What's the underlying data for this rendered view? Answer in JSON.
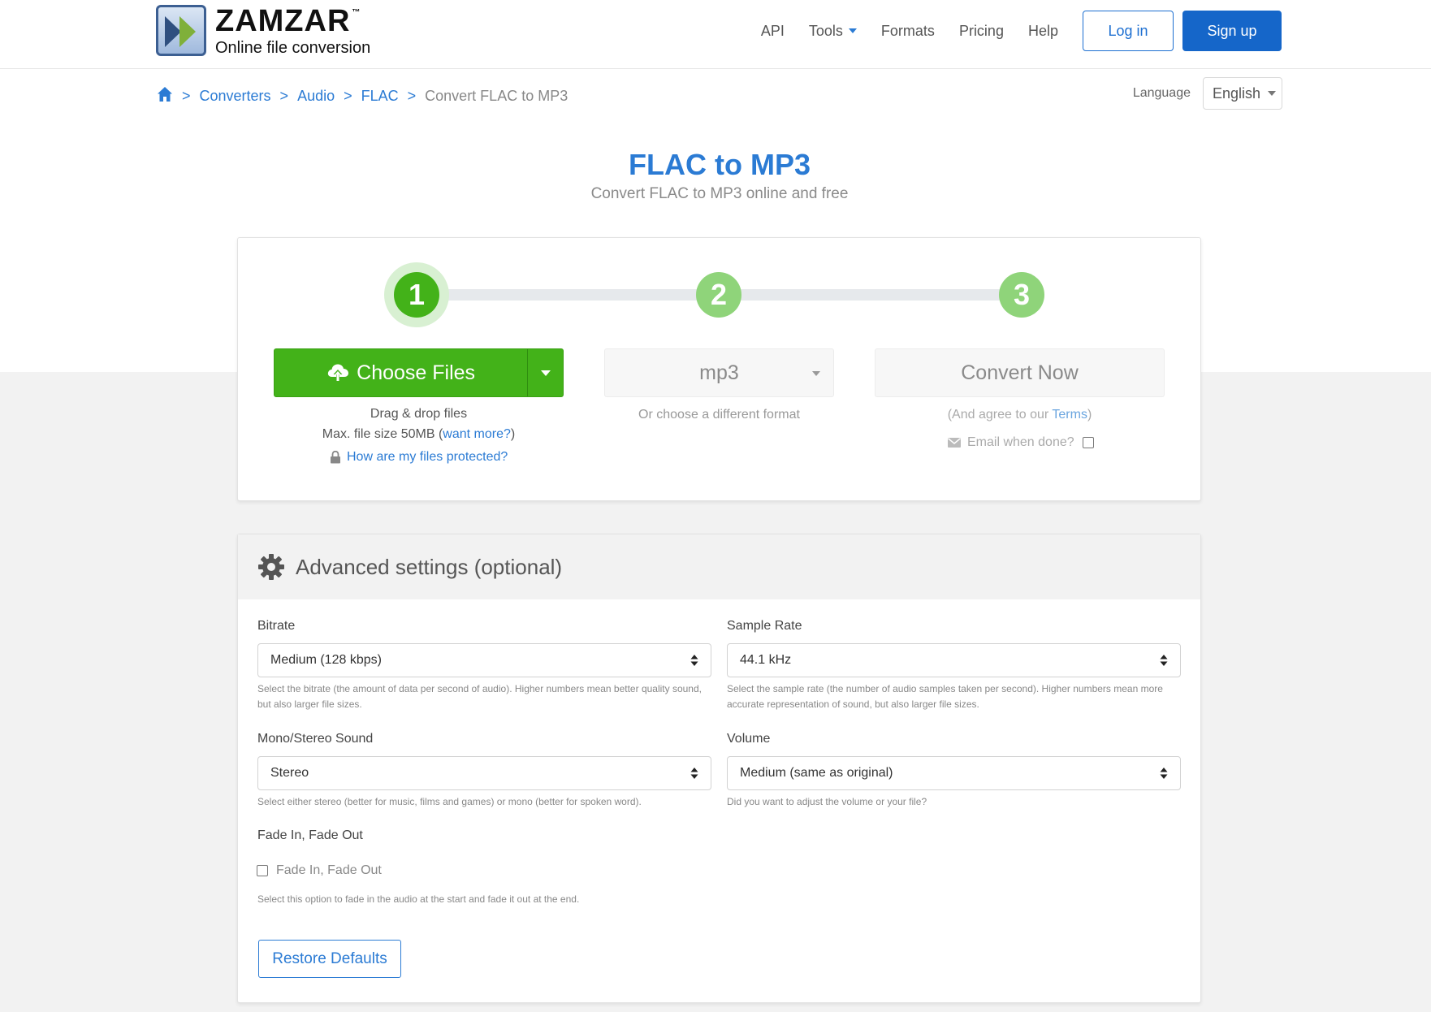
{
  "brand": {
    "name": "ZAMZAR",
    "trademark": "™",
    "tagline": "Online file conversion"
  },
  "nav": {
    "items": [
      {
        "label": "API"
      },
      {
        "label": "Tools"
      },
      {
        "label": "Formats"
      },
      {
        "label": "Pricing"
      },
      {
        "label": "Help"
      }
    ],
    "login_label": "Log in",
    "signup_label": "Sign up"
  },
  "breadcrumb": {
    "items": [
      "Converters",
      "Audio",
      "FLAC"
    ],
    "current": "Convert FLAC to MP3",
    "separator": ">"
  },
  "language": {
    "label": "Language",
    "selected": "English"
  },
  "hero": {
    "title": "FLAC to MP3",
    "subtitle": "Convert FLAC to MP3 online and free"
  },
  "steps": {
    "step1": "1",
    "step2": "2",
    "step3": "3",
    "choose_files_label": "Choose Files",
    "drag_drop": "Drag & drop files",
    "max_size_prefix": "Max. file size 50MB (",
    "want_more": "want more?",
    "max_size_suffix": ")",
    "protected_link": "How are my files protected?",
    "format_value": "mp3",
    "format_hint": "Or choose a different format",
    "convert_label": "Convert Now",
    "terms_prefix": "(And agree to our ",
    "terms_link": "Terms",
    "terms_suffix": ")",
    "email_label": "Email when done?"
  },
  "advanced": {
    "title": "Advanced settings (optional)",
    "bitrate": {
      "label": "Bitrate",
      "value": "Medium (128 kbps)",
      "help": "Select the bitrate (the amount of data per second of audio). Higher numbers mean better quality sound, but also larger file sizes."
    },
    "sample_rate": {
      "label": "Sample Rate",
      "value": "44.1 kHz",
      "help": "Select the sample rate (the number of audio samples taken per second). Higher numbers mean more accurate representation of sound, but also larger file sizes."
    },
    "channels": {
      "label": "Mono/Stereo Sound",
      "value": "Stereo",
      "help": "Select either stereo (better for music, films and games) or mono (better for spoken word)."
    },
    "volume": {
      "label": "Volume",
      "value": "Medium (same as original)",
      "help": "Did you want to adjust the volume or your file?"
    },
    "fade": {
      "label": "Fade In, Fade Out",
      "checkbox_label": "Fade In, Fade Out",
      "help": "Select this option to fade in the audio at the start and fade it out at the end."
    },
    "restore_label": "Restore Defaults"
  },
  "colors": {
    "primary_blue": "#2b7bd4",
    "signup_blue": "#1566c9",
    "green": "#43b219",
    "light_green": "#8fd47a"
  }
}
